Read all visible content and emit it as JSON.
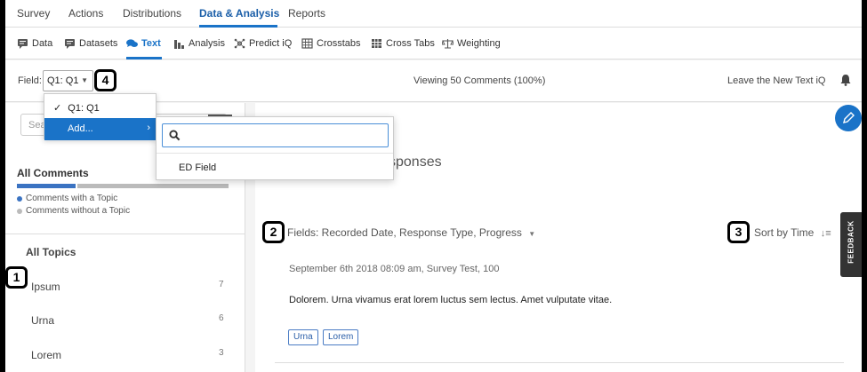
{
  "top_nav": {
    "tabs": [
      "Survey",
      "Actions",
      "Distributions",
      "Data & Analysis",
      "Reports"
    ],
    "active": "Data & Analysis"
  },
  "sub_nav": {
    "items": [
      "Data",
      "Datasets",
      "Text",
      "Analysis",
      "Predict iQ",
      "Crosstabs",
      "Cross Tabs",
      "Weighting"
    ],
    "active": "Text"
  },
  "field_bar": {
    "label": "Field:",
    "selected": "Q1: Q1",
    "viewing": "Viewing 50 Comments (100%)",
    "leave": "Leave the New Text iQ"
  },
  "badges": [
    "1",
    "2",
    "3",
    "4"
  ],
  "left_panel": {
    "search_placeholder": "Sea",
    "all_comments": "All Comments",
    "with_topic": "Comments with a Topic",
    "without_topic": "Comments without a Topic",
    "all_topics": "All Topics",
    "topics": [
      {
        "label": "Ipsum",
        "count": "7"
      },
      {
        "label": "Urna",
        "count": "6"
      },
      {
        "label": "Lorem",
        "count": "3"
      }
    ]
  },
  "content": {
    "title_fragment": "sponses",
    "fields_line": "Fields: Recorded Date, Response Type, Progress",
    "sort_by": "Sort by Time",
    "comment_meta": "September 6th 2018 08:09 am, Survey Test, 100",
    "comment_text": "Dolorem. Urna vivamus erat lorem luctus sem lectus. Amet vulputate vitae.",
    "tags": [
      "Urna",
      "Lorem"
    ]
  },
  "dropdown": {
    "options": [
      "Q1: Q1",
      "Add..."
    ],
    "checked": "Q1: Q1",
    "submenu_items": [
      "ED Field"
    ]
  },
  "feedback_label": "FEEDBACK",
  "colors": {
    "accent": "#1a73c8",
    "topic_bar": "#3b73c2",
    "no_topic_bar": "#bbbbbb"
  }
}
